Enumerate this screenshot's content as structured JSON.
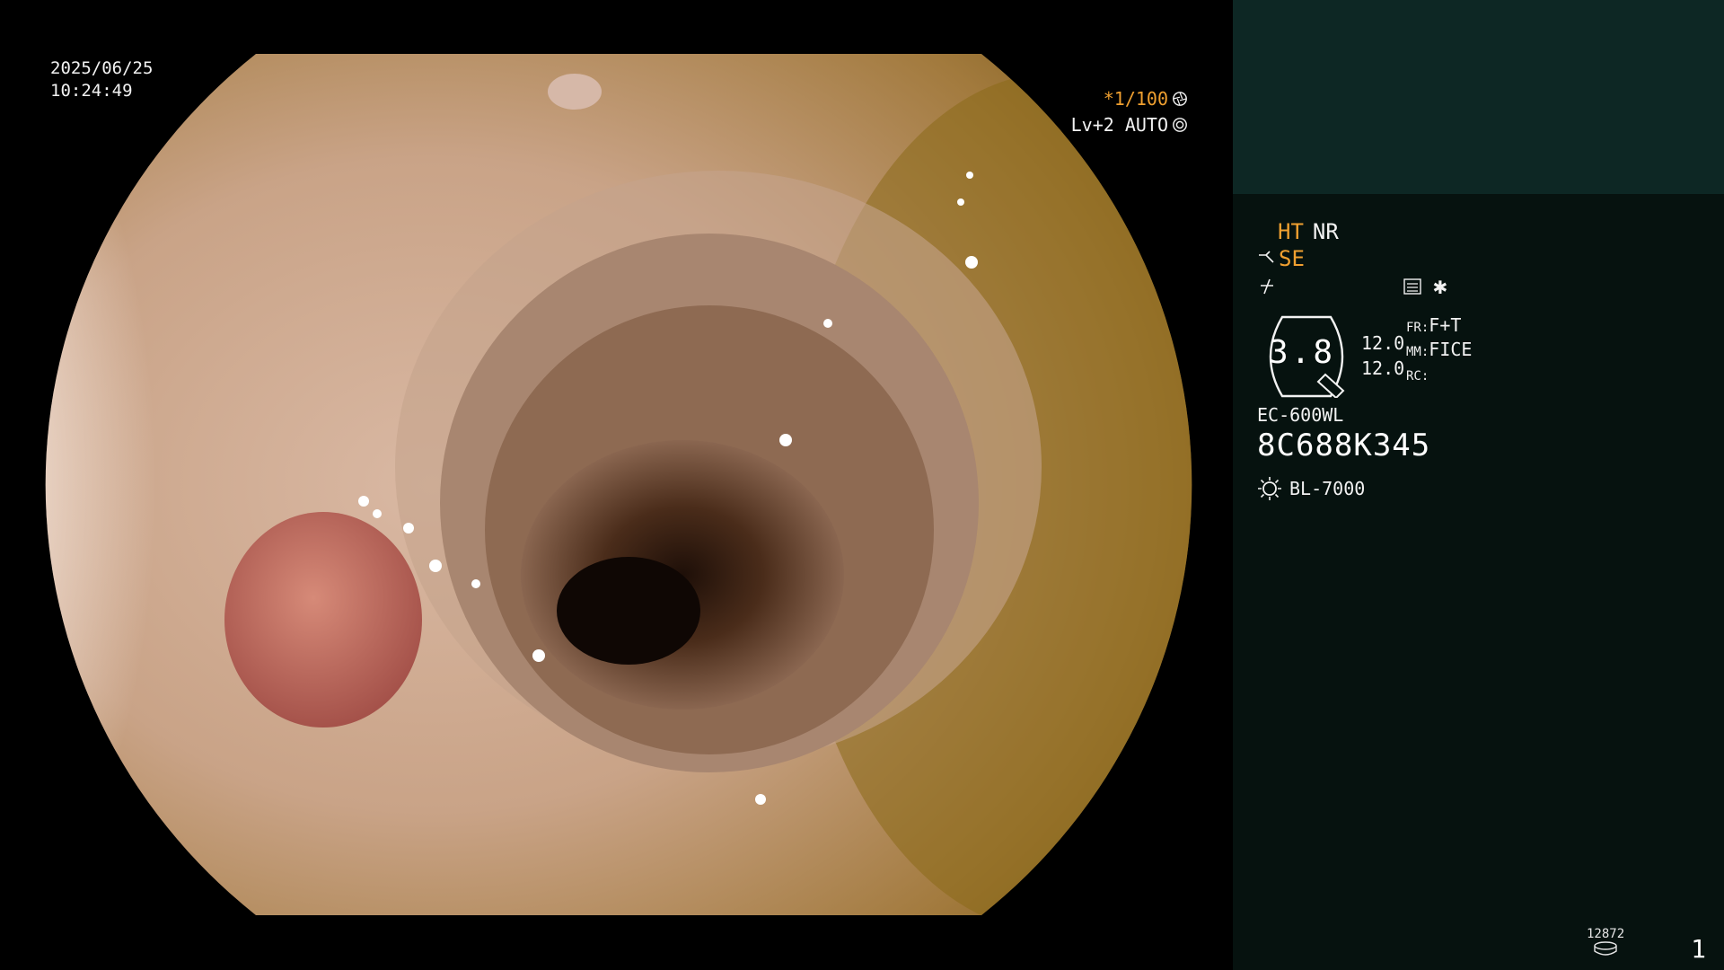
{
  "overlay": {
    "date": "2025/06/25",
    "time": "10:24:49",
    "shutter": "*1/100",
    "level": "Lv+2 AUTO"
  },
  "panel": {
    "ht": "HT",
    "nr": "NR",
    "se": "SE",
    "zoom": "3.8",
    "val1": "12.0",
    "val2": "12.0",
    "fr_label": "FR:",
    "fr_value": "F+T",
    "mm_label": "MM:",
    "mm_value": "FICE",
    "rc_label": "RC:",
    "scope_model": "EC-600WL",
    "serial": "8C688K345",
    "light_source": "BL-7000",
    "counter": "12872",
    "page": "1"
  },
  "colors": {
    "accent": "#f0a030",
    "panel_bg": "#06120f",
    "panel_top": "#0d2724"
  },
  "icons": [
    "aperture-icon",
    "iris-icon",
    "scope-angle-icon",
    "flash-off-icon",
    "settings-card-icon",
    "asterisk-icon",
    "light-bulb-icon",
    "disk-icon"
  ]
}
